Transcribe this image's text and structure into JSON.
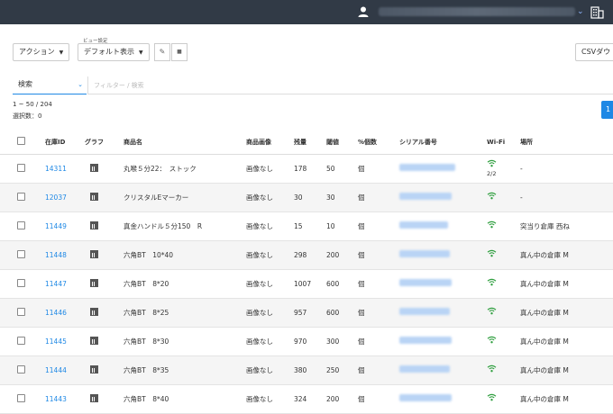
{
  "topbar": {
    "user_name": "",
    "dropdown_glyph": "⌄"
  },
  "toolbar": {
    "action_label": "アクション",
    "view_setting_label": "ビュー設定",
    "view_label": "デフォルト表示",
    "edit_icon": "✎",
    "delete_icon": "🗑",
    "csv_label": "CSVダウ"
  },
  "search": {
    "field_label": "検索",
    "filter_placeholder": "フィルター / 検索"
  },
  "summary": {
    "range_text": "1 ~ 50 / 204",
    "selected_text": "選択数：0",
    "page": "1"
  },
  "table": {
    "headers": [
      "在庫ID",
      "グラフ",
      "商品名",
      "商品画像",
      "残量",
      "閾値",
      "%個数",
      "シリアル番号",
      "Wi-Fi",
      "場所"
    ],
    "rows": [
      {
        "id": "14311",
        "name": "丸喉５分22：　ストック",
        "image": "画像なし",
        "qty": "178",
        "threshold": "50",
        "unit": "個",
        "wifi_sub": "2/2",
        "location": "-"
      },
      {
        "id": "12037",
        "name": "クリスタルEマーカー",
        "image": "画像なし",
        "qty": "30",
        "threshold": "30",
        "unit": "個",
        "wifi_sub": "",
        "location": "-"
      },
      {
        "id": "11449",
        "name": "真金ハンドル５分150　R",
        "image": "画像なし",
        "qty": "15",
        "threshold": "10",
        "unit": "個",
        "wifi_sub": "",
        "location": "突当り倉庫 西ね"
      },
      {
        "id": "11448",
        "name": "六角BT　10*40",
        "image": "画像なし",
        "qty": "298",
        "threshold": "200",
        "unit": "個",
        "wifi_sub": "",
        "location": "真ん中の倉庫 M"
      },
      {
        "id": "11447",
        "name": "六角BT　8*20",
        "image": "画像なし",
        "qty": "1007",
        "threshold": "600",
        "unit": "個",
        "wifi_sub": "",
        "location": "真ん中の倉庫 M"
      },
      {
        "id": "11446",
        "name": "六角BT　8*25",
        "image": "画像なし",
        "qty": "957",
        "threshold": "600",
        "unit": "個",
        "wifi_sub": "",
        "location": "真ん中の倉庫 M"
      },
      {
        "id": "11445",
        "name": "六角BT　8*30",
        "image": "画像なし",
        "qty": "970",
        "threshold": "300",
        "unit": "個",
        "wifi_sub": "",
        "location": "真ん中の倉庫 M"
      },
      {
        "id": "11444",
        "name": "六角BT　8*35",
        "image": "画像なし",
        "qty": "380",
        "threshold": "250",
        "unit": "個",
        "wifi_sub": "",
        "location": "真ん中の倉庫 M"
      },
      {
        "id": "11443",
        "name": "六角BT　8*40",
        "image": "画像なし",
        "qty": "324",
        "threshold": "200",
        "unit": "個",
        "wifi_sub": "",
        "location": "真ん中の倉庫 M"
      }
    ]
  },
  "colors": {
    "topbar": "#313a46",
    "accent": "#1e88e5",
    "wifi": "#2e9e3e"
  },
  "icons": {
    "user": "user-icon",
    "building": "building-icon",
    "graph": "bar-chart-icon",
    "wifi": "wifi-icon"
  }
}
